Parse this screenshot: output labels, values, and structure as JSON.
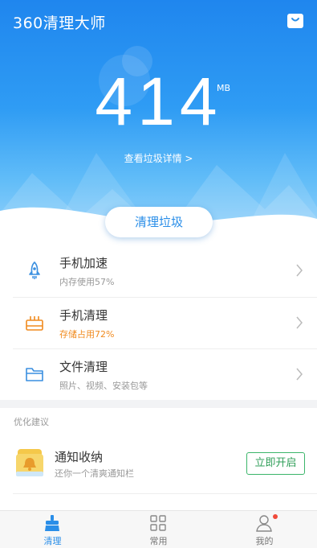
{
  "header": {
    "app_title": "360清理大师",
    "bag_icon": "shopping-bag-icon"
  },
  "junk": {
    "value": "414",
    "unit": "MB",
    "detail_link": "查看垃圾详情 >"
  },
  "clean_button": {
    "label": "清理垃圾"
  },
  "features": [
    {
      "title": "手机加速",
      "subtitle": "内存使用57%",
      "icon": "rocket-icon",
      "subtitle_color": "#999999"
    },
    {
      "title": "手机清理",
      "subtitle": "存储占用72%",
      "icon": "storage-icon",
      "subtitle_color": "#f08a1e"
    },
    {
      "title": "文件清理",
      "subtitle": "照片、视频、安装包等",
      "icon": "folder-icon",
      "subtitle_color": "#999999"
    }
  ],
  "suggestions": {
    "section_label": "优化建议",
    "items": [
      {
        "title": "通知收纳",
        "subtitle": "还你一个清爽通知栏",
        "button": "立即开启",
        "icon": "notification-bell-icon"
      }
    ]
  },
  "tabbar": {
    "tabs": [
      {
        "label": "清理",
        "icon": "broom-icon",
        "active": true
      },
      {
        "label": "常用",
        "icon": "grid-icon",
        "active": false
      },
      {
        "label": "我的",
        "icon": "person-icon",
        "active": false,
        "badge": true
      }
    ]
  },
  "colors": {
    "primary_blue": "#2a8ee8",
    "warning_orange": "#f08a1e",
    "green": "#3bb56a",
    "badge_red": "#f04a3a"
  }
}
